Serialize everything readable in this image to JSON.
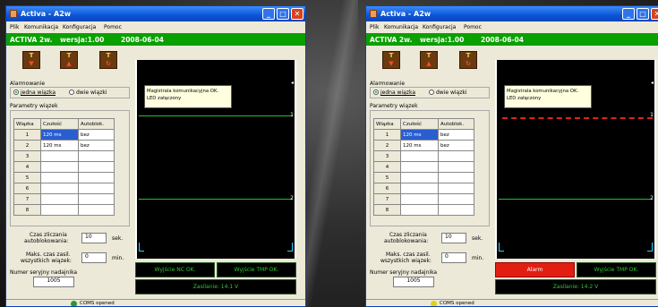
{
  "windows": [
    {
      "title": "Activa - A2w",
      "menu": [
        "Plik",
        "Komunikacja",
        "Konfiguracja",
        "Pomoc"
      ],
      "device": {
        "name": "ACTIVA 2w.",
        "version": "wersja:1.00",
        "date": "2008-06-04"
      },
      "alarm_group": {
        "label": "Alarmowanie",
        "option1": "jedna wiązka",
        "option2": "dwie wiązki",
        "selected": "jedna wiązka"
      },
      "params": {
        "label": "Parametry wiązek",
        "headers": [
          "Wiązka",
          "Czułość",
          "Autoblok."
        ],
        "rows": [
          {
            "n": "1",
            "c": "120 ms",
            "a": "bez"
          },
          {
            "n": "2",
            "c": "120 ms",
            "a": "bez"
          },
          {
            "n": "3",
            "c": "",
            "a": ""
          },
          {
            "n": "4",
            "c": "",
            "a": ""
          },
          {
            "n": "5",
            "c": "",
            "a": ""
          },
          {
            "n": "6",
            "c": "",
            "a": ""
          },
          {
            "n": "7",
            "c": "",
            "a": ""
          },
          {
            "n": "8",
            "c": "",
            "a": ""
          }
        ]
      },
      "count_time": {
        "label1": "Czas zliczania",
        "label2": "autoblokowania:",
        "value": "10",
        "unit": "sek."
      },
      "max_time": {
        "label1": "Maks. czas zasil.",
        "label2": "wszystkich wiązek:",
        "value": "0",
        "unit": "min."
      },
      "serial": {
        "label": "Numer seryjny nadajnika",
        "value": "1005"
      },
      "scope": {
        "tooltip_line1": "Magistrala komunikacyjna OK.",
        "tooltip_line2": "LED załączony",
        "marker1": "1",
        "marker2": "2",
        "marker_top": "◂"
      },
      "status_boxes": {
        "out1": "Wyjście NC OK.",
        "out2": "Wyjście TMP OK.",
        "power": "Zasilanie: 14.1 V"
      },
      "statusbar": "COMS opened"
    },
    {
      "title": "Activa - A2w",
      "menu": [
        "Plik",
        "Komunikacja",
        "Konfiguracja",
        "Pomoc"
      ],
      "device": {
        "name": "ACTIVA 2w.",
        "version": "wersja:1.00",
        "date": "2008-06-04"
      },
      "alarm_group": {
        "label": "Alarmowanie",
        "option1": "jedna wiązka",
        "option2": "dwie wiązki",
        "selected": "jedna wiązka"
      },
      "params": {
        "label": "Parametry wiązek",
        "headers": [
          "Wiązka",
          "Czułość",
          "Autoblok."
        ],
        "rows": [
          {
            "n": "1",
            "c": "120 ms",
            "a": "bez"
          },
          {
            "n": "2",
            "c": "120 ms",
            "a": "bez"
          },
          {
            "n": "3",
            "c": "",
            "a": ""
          },
          {
            "n": "4",
            "c": "",
            "a": ""
          },
          {
            "n": "5",
            "c": "",
            "a": ""
          },
          {
            "n": "6",
            "c": "",
            "a": ""
          },
          {
            "n": "7",
            "c": "",
            "a": ""
          },
          {
            "n": "8",
            "c": "",
            "a": ""
          }
        ]
      },
      "count_time": {
        "label1": "Czas zliczania",
        "label2": "autoblokowania:",
        "value": "10",
        "unit": "sek."
      },
      "max_time": {
        "label1": "Maks. czas zasil.",
        "label2": "wszystkich wiązek:",
        "value": "0",
        "unit": "min."
      },
      "serial": {
        "label": "Numer seryjny nadajnika",
        "value": "1005"
      },
      "scope": {
        "tooltip_line1": "Magistrala komunikacyjna OK.",
        "tooltip_line2": "LED załączony",
        "marker1": "1",
        "marker2": "2",
        "marker_top": "◂"
      },
      "status_boxes": {
        "out1": "Alarm",
        "out2": "Wyjście TMP OK.",
        "power": "Zasilanie: 14.2 V"
      },
      "statusbar": "COMS opened"
    }
  ],
  "colors": {
    "device_bar": "#0aa000",
    "alarm": "#e21e12",
    "trace": "#28c028",
    "alarm_trace": "#e02020"
  }
}
